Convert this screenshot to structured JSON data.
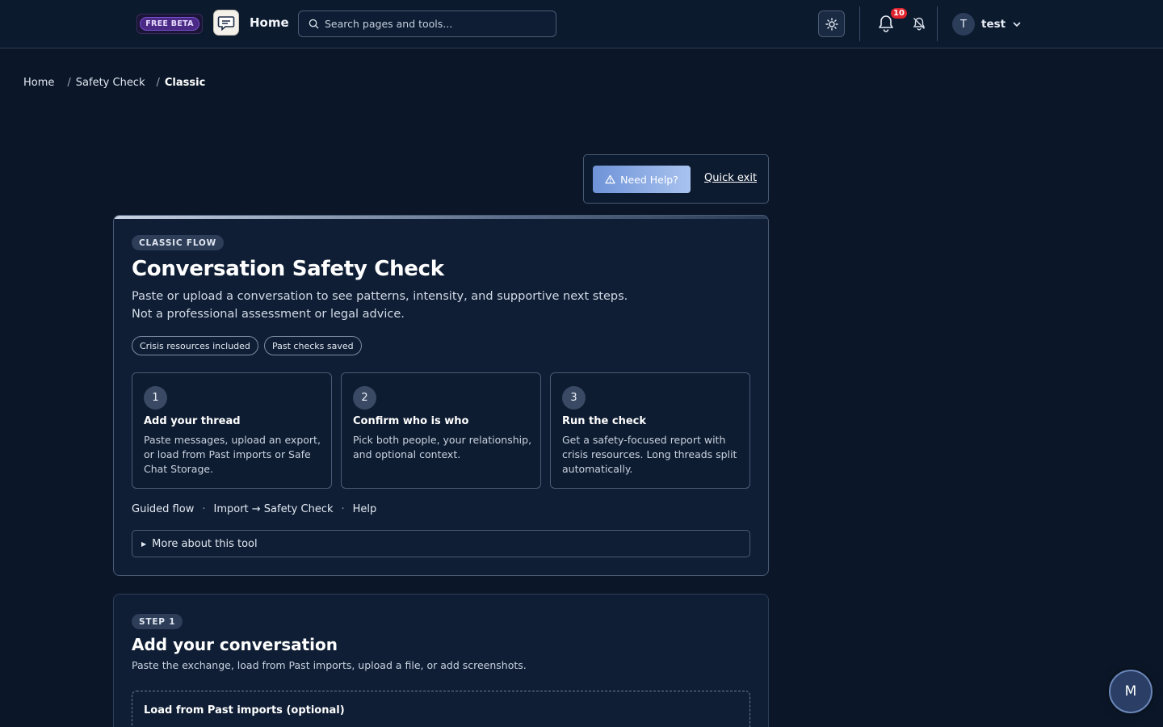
{
  "header": {
    "beta_label": "FREE BETA",
    "home_label": "Home",
    "search_placeholder": "Search pages and tools...",
    "notification_count": "10",
    "user_initial": "T",
    "user_name": "test"
  },
  "breadcrumb": {
    "items": [
      "Home",
      "Safety Check",
      "Classic"
    ],
    "separator": "/"
  },
  "help": {
    "need_help_label": "Need Help?",
    "quick_exit_label": "Quick exit"
  },
  "intro_card": {
    "badge": "CLASSIC FLOW",
    "title": "Conversation Safety Check",
    "subtitle_line1": "Paste or upload a conversation to see patterns, intensity, and supportive next steps.",
    "subtitle_line2": "Not a professional assessment or legal advice.",
    "chips": [
      "Crisis resources included",
      "Past checks saved"
    ],
    "steps": [
      {
        "num": "1",
        "title": "Add your thread",
        "desc": "Paste messages, upload an export, or load from Past imports or Safe Chat Storage."
      },
      {
        "num": "2",
        "title": "Confirm who is who",
        "desc": "Pick both people, your relationship, and optional context."
      },
      {
        "num": "3",
        "title": "Run the check",
        "desc": "Get a safety-focused report with crisis resources. Long threads split automatically."
      }
    ],
    "links": [
      "Guided flow",
      "Import → Safety Check",
      "Help"
    ],
    "link_separator": "·",
    "more_label": "More about this tool"
  },
  "step1_card": {
    "badge": "STEP 1",
    "title": "Add your conversation",
    "subtitle": "Paste the exchange, load from Past imports, upload a file, or add screenshots.",
    "load_title": "Load from Past imports (optional)"
  },
  "fab": {
    "label": "M"
  },
  "colors": {
    "background": "#0b1729",
    "card": "#0f1e35",
    "border": "#4a5b75",
    "accent_button": "#8fb0e6",
    "notification_badge": "#e0242e",
    "beta_purple": "#4b2a86"
  }
}
